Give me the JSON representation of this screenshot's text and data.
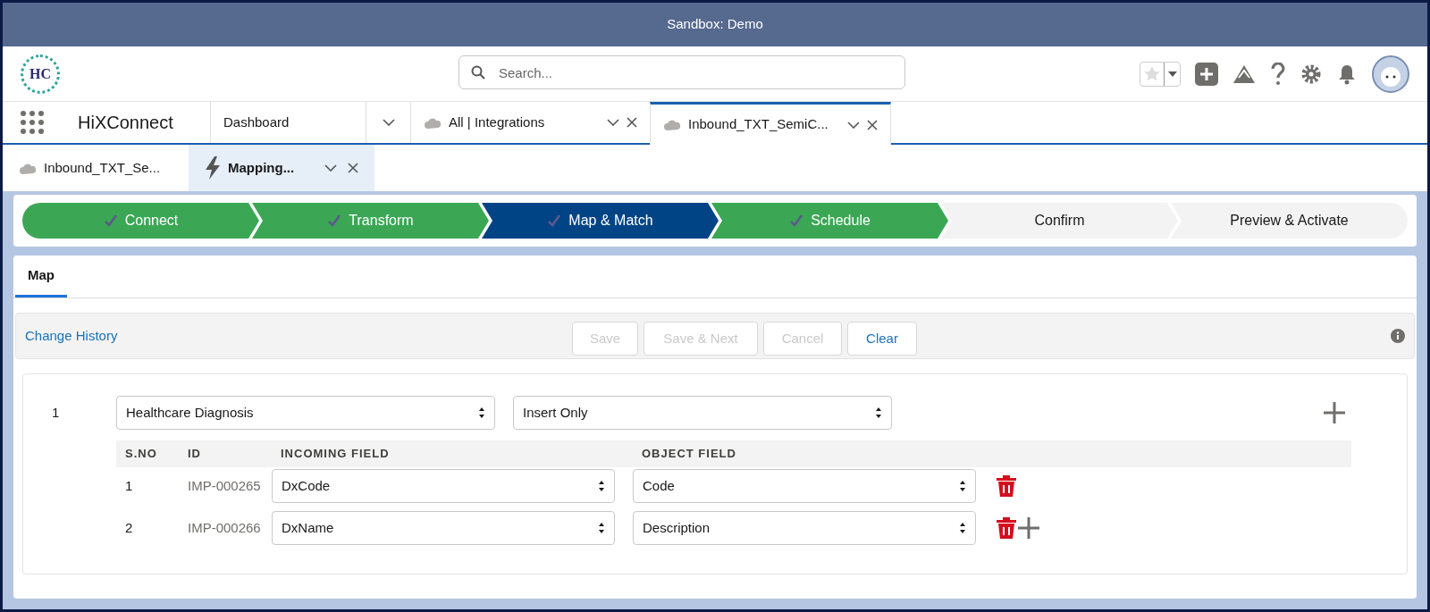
{
  "banner": {
    "title": "Sandbox: Demo"
  },
  "header": {
    "logo_text": "HC",
    "search": {
      "placeholder": "Search..."
    }
  },
  "nav": {
    "app_name": "HiXConnect",
    "tabs": [
      {
        "label": "Dashboard",
        "kind": "menu",
        "selected": false
      },
      {
        "label": "All | Integrations",
        "kind": "object",
        "selected": false
      },
      {
        "label": "Inbound_TXT_SemiC...",
        "kind": "object",
        "selected": true
      }
    ]
  },
  "subtabs": [
    {
      "label": "Inbound_TXT_Se...",
      "kind": "object",
      "selected": false
    },
    {
      "label": "Mapping...",
      "kind": "flash",
      "selected": true
    }
  ],
  "path": [
    {
      "label": "Connect",
      "completed": true,
      "selected": false
    },
    {
      "label": "Transform",
      "completed": true,
      "selected": false
    },
    {
      "label": "Map & Match",
      "completed": true,
      "selected": true
    },
    {
      "label": "Schedule",
      "completed": true,
      "selected": false
    },
    {
      "label": "Confirm",
      "completed": false,
      "selected": false
    },
    {
      "label": "Preview & Activate",
      "completed": false,
      "selected": false
    }
  ],
  "section_tabs": [
    {
      "label": "Map",
      "selected": true
    }
  ],
  "toolbar": {
    "link": "Change History",
    "buttons": [
      {
        "label": "Save",
        "disabled": true
      },
      {
        "label": "Save & Next",
        "disabled": true
      },
      {
        "label": "Cancel",
        "disabled": true
      },
      {
        "label": "Clear",
        "disabled": false
      }
    ]
  },
  "mapping": {
    "number": "1",
    "object": "Healthcare Diagnosis",
    "operation": "Insert Only",
    "columns": [
      "S.NO",
      "ID",
      "INCOMING FIELD",
      "OBJECT FIELD"
    ],
    "rows": [
      {
        "sno": "1",
        "id": "IMP-000265",
        "incoming": "DxCode",
        "object_field": "Code",
        "can_add": false
      },
      {
        "sno": "2",
        "id": "IMP-000266",
        "incoming": "DxName",
        "object_field": "Description",
        "can_add": true
      }
    ]
  }
}
